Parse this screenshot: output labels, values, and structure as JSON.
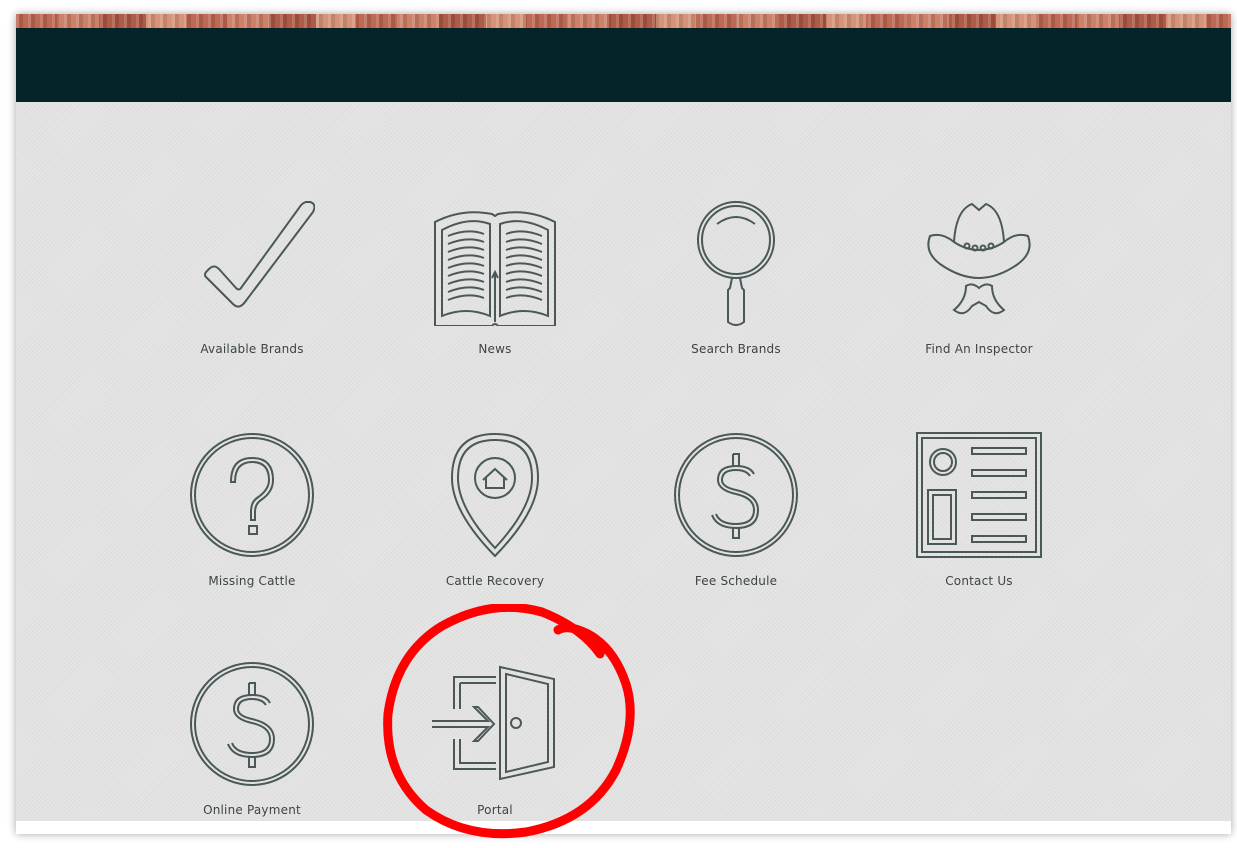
{
  "page": {
    "colors": {
      "header": "#04242a",
      "background": "#e3e3e3",
      "icon_stroke": "#4a5858",
      "label": "#3d4444",
      "annotation": "#ff0000"
    }
  },
  "tiles": [
    {
      "label": "Available Brands",
      "icon": "checkmark-icon"
    },
    {
      "label": "News",
      "icon": "open-book-icon"
    },
    {
      "label": "Search Brands",
      "icon": "magnifying-glass-icon"
    },
    {
      "label": "Find An Inspector",
      "icon": "cowboy-face-icon"
    },
    {
      "label": "Missing Cattle",
      "icon": "question-circle-icon"
    },
    {
      "label": "Cattle Recovery",
      "icon": "home-location-pin-icon"
    },
    {
      "label": "Fee Schedule",
      "icon": "dollar-circle-icon"
    },
    {
      "label": "Contact Us",
      "icon": "contact-card-icon"
    },
    {
      "label": "Online Payment",
      "icon": "dollar-circle-icon"
    },
    {
      "label": "Portal",
      "icon": "door-enter-icon"
    }
  ],
  "annotation": {
    "shape": "hand-drawn circle",
    "target": "Portal"
  }
}
